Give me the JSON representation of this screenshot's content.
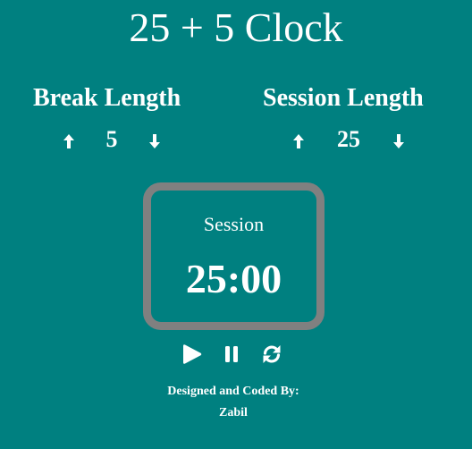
{
  "app": {
    "title": "25 + 5 Clock"
  },
  "break": {
    "label": "Break Length",
    "value": "5",
    "increment_icon": "arrow-up-icon",
    "decrement_icon": "arrow-down-icon"
  },
  "session": {
    "label": "Session Length",
    "value": "25",
    "increment_icon": "arrow-up-icon",
    "decrement_icon": "arrow-down-icon"
  },
  "timer": {
    "label": "Session",
    "time": "25:00"
  },
  "controls": {
    "play_icon": "play-icon",
    "pause_icon": "pause-icon",
    "reset_icon": "refresh-icon"
  },
  "footer": {
    "line1": "Designed and Coded By:",
    "line2": "Zabil"
  },
  "colors": {
    "background": "#008080",
    "text": "#ffffff",
    "timer_border": "#808080"
  }
}
